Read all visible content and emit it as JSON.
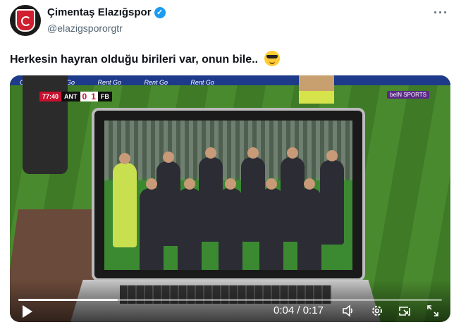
{
  "header": {
    "display_name": "Çimentaş Elazığspor",
    "handle": "@elazigspororgtr",
    "more_label": "···"
  },
  "tweet": {
    "text": "Herkesin hayran olduğu birileri var, onun bile.."
  },
  "video": {
    "scorebug": {
      "time": "77:40",
      "home": "ANT",
      "home_score": "0",
      "away_score": "1",
      "away": "FB"
    },
    "broadcaster": "beIN SPORTS",
    "ad_text": [
      "Go",
      "Rent Go",
      "Rent Go",
      "Rent Go",
      "Rent Go"
    ],
    "current_time": "0:04",
    "duration": "0:17",
    "progress_fraction": 0.235
  },
  "icons": {
    "play": "play-icon",
    "volume": "volume-icon",
    "settings": "settings-icon",
    "pip": "picture-in-picture-icon",
    "fullscreen": "fullscreen-icon"
  },
  "colors": {
    "verified": "#1d9bf0",
    "accent_red": "#c8102e"
  }
}
